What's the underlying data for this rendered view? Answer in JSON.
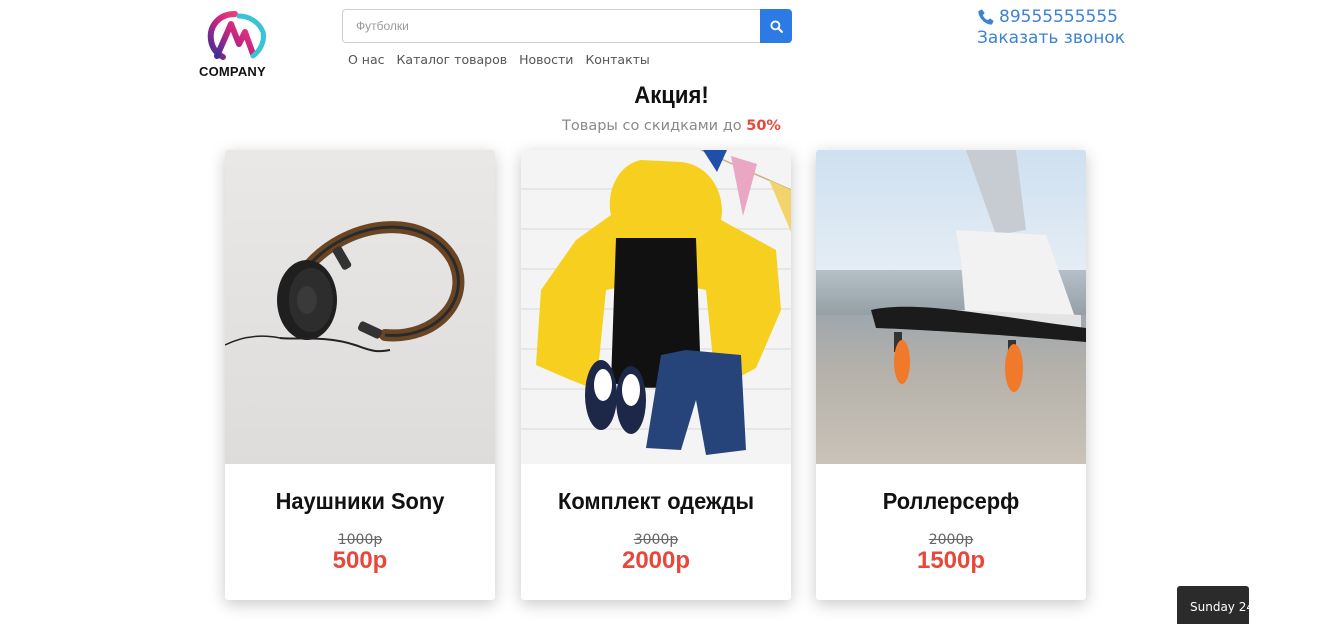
{
  "brand": {
    "logo_text": "COMPANY"
  },
  "search": {
    "placeholder": "Футболки",
    "value": ""
  },
  "nav": {
    "items": [
      "О нас",
      "Каталог товаров",
      "Новости",
      "Контакты"
    ]
  },
  "contacts": {
    "phone": "89555555555",
    "callback": "Заказать звонок"
  },
  "promo": {
    "title": "Акция!",
    "subtitle": "Товары со скидками до",
    "percent": "50%"
  },
  "products": [
    {
      "name": "Наушники Sony",
      "old_price": "1000р",
      "new_price": "500р"
    },
    {
      "name": "Комплект одежды",
      "old_price": "3000р",
      "new_price": "2000р"
    },
    {
      "name": "Роллерсерф",
      "old_price": "2000р",
      "new_price": "1500р"
    }
  ],
  "date_widget": {
    "text": "Sunday 24"
  },
  "colors": {
    "accent": "#2c7be5",
    "link": "#3d82d5",
    "sale": "#e8473a"
  }
}
